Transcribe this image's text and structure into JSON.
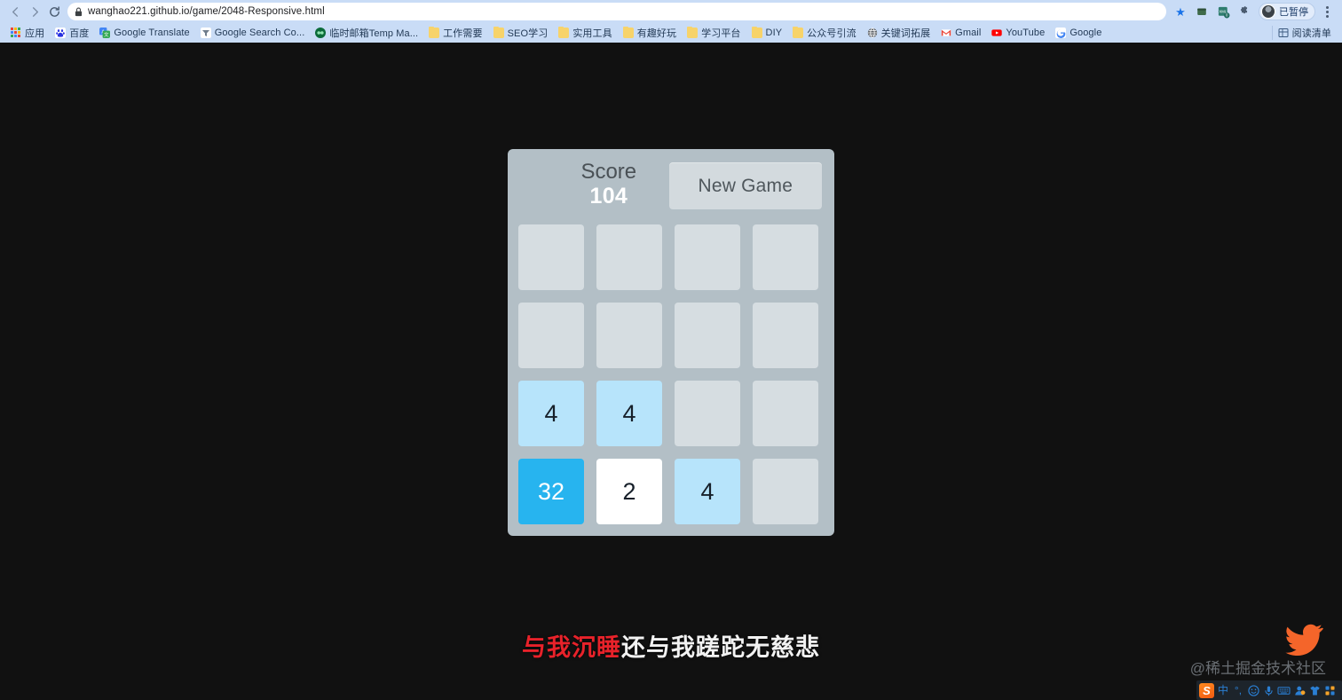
{
  "browser": {
    "back_icon": "back-arrow-icon",
    "forward_icon": "forward-arrow-icon",
    "reload_icon": "reload-icon",
    "lock_icon": "lock-icon",
    "url": "wanghao221.github.io/game/2048-Responsive.html",
    "star_icon": "bookmark-star-icon",
    "extension_icons": [
      "wallet-icon",
      "xml-badge-icon",
      "puzzle-extensions-icon"
    ],
    "profile": {
      "label": "已暂停",
      "avatar_icon": "profile-avatar"
    },
    "menu_icon": "three-dot-menu-icon",
    "toolbar_bg": "#c9dcf6"
  },
  "bookmarks": {
    "items": [
      {
        "label": "应用",
        "icon": "apps-grid-icon"
      },
      {
        "label": "百度",
        "icon": "baidu-icon",
        "color": "#2932e1"
      },
      {
        "label": "Google Translate",
        "icon": "google-translate-icon",
        "color": "#4285f4"
      },
      {
        "label": "Google Search Co...",
        "icon": "search-console-icon",
        "color": "#5f6368"
      },
      {
        "label": "临时邮箱Temp Ma...",
        "icon": "temp-mail-icon",
        "color": "#0b6b3a"
      },
      {
        "label": "工作需要",
        "icon": "folder-icon"
      },
      {
        "label": "SEO学习",
        "icon": "folder-icon"
      },
      {
        "label": "实用工具",
        "icon": "folder-icon"
      },
      {
        "label": "有趣好玩",
        "icon": "folder-icon"
      },
      {
        "label": "学习平台",
        "icon": "folder-icon"
      },
      {
        "label": "DIY",
        "icon": "folder-icon"
      },
      {
        "label": "公众号引流",
        "icon": "folder-icon"
      },
      {
        "label": "关键词拓展",
        "icon": "globe-icon",
        "color": "#5f6368"
      },
      {
        "label": "Gmail",
        "icon": "gmail-icon",
        "color": "#ea4335"
      },
      {
        "label": "YouTube",
        "icon": "youtube-icon",
        "color": "#ff0000"
      },
      {
        "label": "Google",
        "icon": "google-g-icon",
        "color": "#4285f4"
      }
    ],
    "reading_list": {
      "label": "阅读清单",
      "icon": "reading-list-icon"
    }
  },
  "game": {
    "score_label": "Score",
    "score_value": "104",
    "new_game_label": "New Game",
    "board_bg": "#b3bfc6",
    "empty_tile_color": "#d6dde1",
    "tile_colors": {
      "2": "#ffffff",
      "4": "#b7e4fb",
      "32": "#27b4ef"
    },
    "grid": [
      [
        "",
        "",
        "",
        ""
      ],
      [
        "",
        "",
        "",
        ""
      ],
      [
        "4",
        "4",
        "",
        ""
      ],
      [
        "32",
        "2",
        "4",
        ""
      ]
    ]
  },
  "subtitle": {
    "highlight": "与我沉睡",
    "rest": "还与我蹉跎无慈悲",
    "highlight_color": "#e8222a",
    "rest_color": "#f2f2f2"
  },
  "watermark": {
    "text": "@稀土掘金技术社区",
    "bird_icon": "twitter-bird-icon",
    "bird_color": "#f4652a"
  },
  "ime": {
    "logo": "S",
    "items": [
      {
        "glyph": "中",
        "icon": "chinese-mode-icon"
      },
      {
        "glyph": "°,",
        "icon": "punctuation-mode-icon"
      },
      {
        "glyph": "☺",
        "icon": "emoji-icon"
      },
      {
        "glyph": "🎤",
        "icon": "voice-input-icon"
      },
      {
        "glyph": "⌨",
        "icon": "soft-keyboard-icon"
      },
      {
        "glyph": "👤",
        "icon": "user-center-icon"
      },
      {
        "glyph": "👕",
        "icon": "skin-theme-icon"
      },
      {
        "glyph": "▦",
        "icon": "toolbox-grid-icon"
      }
    ]
  },
  "page_bg": "#111111"
}
